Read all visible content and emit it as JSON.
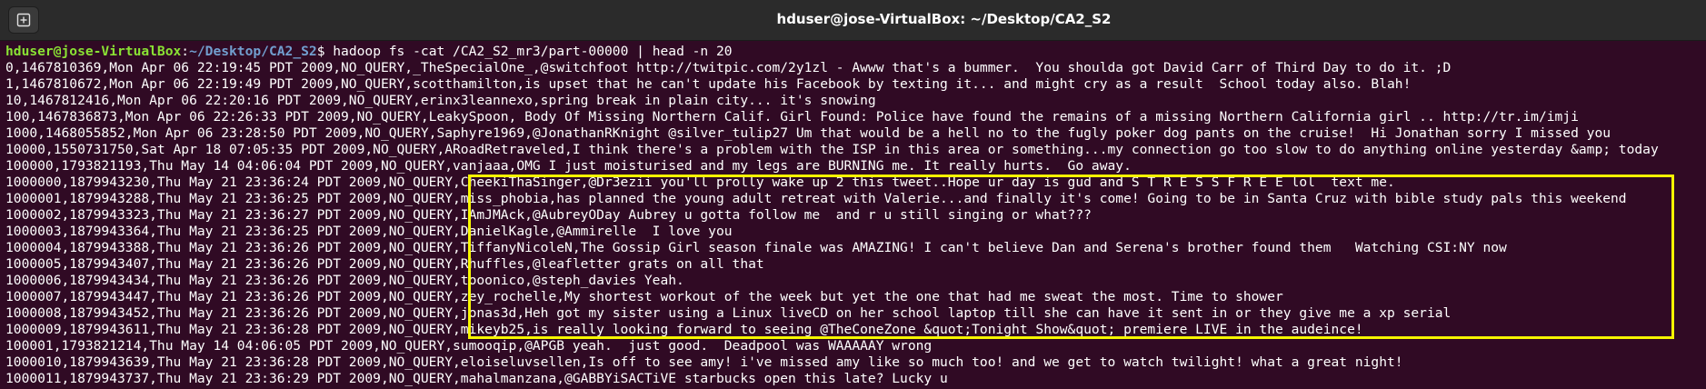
{
  "window": {
    "title": "hduser@jose-VirtualBox: ~/Desktop/CA2_S2"
  },
  "prompt": {
    "user_host": "hduser@jose-VirtualBox",
    "sep": ":",
    "path": "~/Desktop/CA2_S2",
    "symbol": "$ ",
    "command": "hadoop fs -cat /CA2_S2_mr3/part-00000 | head -n 20"
  },
  "output_lines": [
    "0,1467810369,Mon Apr 06 22:19:45 PDT 2009,NO_QUERY,_TheSpecialOne_,@switchfoot http://twitpic.com/2y1zl - Awww that's a bummer.  You shoulda got David Carr of Third Day to do it. ;D",
    "1,1467810672,Mon Apr 06 22:19:49 PDT 2009,NO_QUERY,scotthamilton,is upset that he can't update his Facebook by texting it... and might cry as a result  School today also. Blah!",
    "10,1467812416,Mon Apr 06 22:20:16 PDT 2009,NO_QUERY,erinx3leannexo,spring break in plain city... it's snowing",
    "100,1467836873,Mon Apr 06 22:26:33 PDT 2009,NO_QUERY,LeakySpoon, Body Of Missing Northern Calif. Girl Found: Police have found the remains of a missing Northern California girl .. http://tr.im/imji",
    "1000,1468055852,Mon Apr 06 23:28:50 PDT 2009,NO_QUERY,Saphyre1969,@JonathanRKnight @silver_tulip27 Um that would be a hell no to the fugly poker dog pants on the cruise!  Hi Jonathan sorry I missed you",
    "10000,1550731750,Sat Apr 18 07:05:35 PDT 2009,NO_QUERY,ARoadRetraveled,I think there's a problem with the ISP in this area or something...my connection go too slow to do anything online yesterday &amp; today",
    "100000,1793821193,Thu May 14 04:06:04 PDT 2009,NO_QUERY,vanjaaa,OMG I just moisturised and my legs are BURNING me. It really hurts.  Go away.",
    "1000000,1879943230,Thu May 21 23:36:24 PDT 2009,NO_QUERY,CheekiThaSinger,@Dr3ezii you'll prolly wake up 2 this tweet..Hope ur day is gud and S T R E S S F R E E lol  text me.",
    "1000001,1879943288,Thu May 21 23:36:25 PDT 2009,NO_QUERY,miss_phobia,has planned the young adult retreat with Valerie...and finally it's come! Going to be in Santa Cruz with bible study pals this weekend",
    "1000002,1879943323,Thu May 21 23:36:27 PDT 2009,NO_QUERY,IAmJMAck,@AubreyODay Aubrey u gotta follow me  and r u still singing or what???",
    "1000003,1879943364,Thu May 21 23:36:25 PDT 2009,NO_QUERY,DanielKagle,@Ammirelle  I love you",
    "1000004,1879943388,Thu May 21 23:36:26 PDT 2009,NO_QUERY,TiffanyNicoleN,The Gossip Girl season finale was AMAZING! I can't believe Dan and Serena's brother found them   Watching CSI:NY now",
    "1000005,1879943407,Thu May 21 23:36:26 PDT 2009,NO_QUERY,Rhuffles,@leafletter grats on all that",
    "1000006,1879943434,Thu May 21 23:36:26 PDT 2009,NO_QUERY,tooonico,@steph_davies Yeah.",
    "1000007,1879943447,Thu May 21 23:36:26 PDT 2009,NO_QUERY,zey_rochelle,My shortest workout of the week but yet the one that had me sweat the most. Time to shower",
    "1000008,1879943452,Thu May 21 23:36:26 PDT 2009,NO_QUERY,jonas3d,Heh got my sister using a Linux liveCD on her school laptop till she can have it sent in or they give me a xp serial",
    "1000009,1879943611,Thu May 21 23:36:28 PDT 2009,NO_QUERY,mikeyb25,is really looking forward to seeing @TheConeZone &quot;Tonight Show&quot; premiere LIVE in the audeince!",
    "100001,1793821214,Thu May 14 04:06:05 PDT 2009,NO_QUERY,sumooqip,@APGB yeah.  just good.  Deadpool was WAAAAAY wrong",
    "1000010,1879943639,Thu May 21 23:36:28 PDT 2009,NO_QUERY,eloiseluvsellen,Is off to see amy! i've missed amy like so much too! and we get to watch twilight! what a great night!",
    "1000011,1879943737,Thu May 21 23:36:29 PDT 2009,NO_QUERY,mahalmanzana,@GABBYiSACTiVE starbucks open this late? Lucky u"
  ],
  "colors": {
    "terminal_bg": "#300a24",
    "titlebar_bg": "#2b2b2b",
    "prompt_user": "#8ae234",
    "prompt_path": "#729fcf",
    "highlight": "#f5f500"
  },
  "icons": {
    "new_tab": "new-tab-icon"
  }
}
